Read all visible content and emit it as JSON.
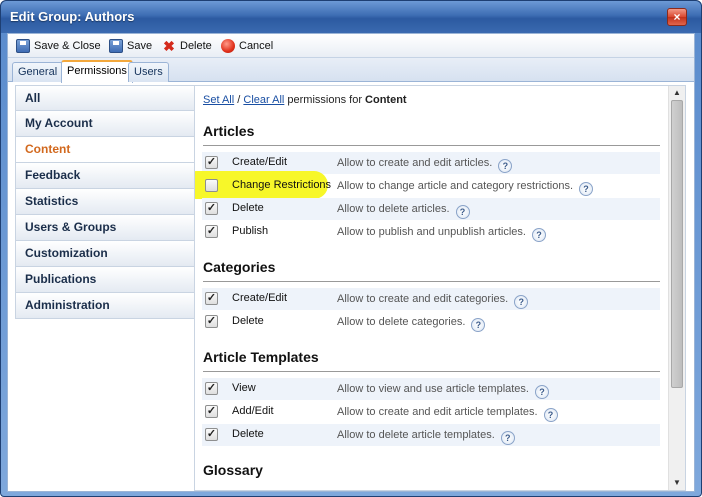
{
  "window": {
    "title": "Edit Group: Authors",
    "close_glyph": "×"
  },
  "toolbar": {
    "save_close": "Save & Close",
    "save": "Save",
    "delete": "Delete",
    "cancel": "Cancel"
  },
  "tabs": [
    {
      "label": "General"
    },
    {
      "label": "Permissions",
      "active": true
    },
    {
      "label": "Users"
    }
  ],
  "sidebar": {
    "items": [
      {
        "label": "All"
      },
      {
        "label": "My Account"
      },
      {
        "label": "Content",
        "active": true
      },
      {
        "label": "Feedback"
      },
      {
        "label": "Statistics"
      },
      {
        "label": "Users & Groups"
      },
      {
        "label": "Customization"
      },
      {
        "label": "Publications"
      },
      {
        "label": "Administration"
      }
    ]
  },
  "content": {
    "set_all": "Set All",
    "separator": "/",
    "clear_all": "Clear All",
    "permissions_for": "permissions for",
    "target": "Content",
    "help_glyph": "?",
    "sections": [
      {
        "title": "Articles",
        "rows": [
          {
            "name": "Create/Edit",
            "desc": "Allow to create and edit articles.",
            "checked": true
          },
          {
            "name": "Change Restrictions",
            "desc": "Allow to change article and category restrictions.",
            "checked": false,
            "highlighted": true
          },
          {
            "name": "Delete",
            "desc": "Allow to delete articles.",
            "checked": true
          },
          {
            "name": "Publish",
            "desc": "Allow to publish and unpublish articles.",
            "checked": true
          }
        ]
      },
      {
        "title": "Categories",
        "rows": [
          {
            "name": "Create/Edit",
            "desc": "Allow to create and edit categories.",
            "checked": true
          },
          {
            "name": "Delete",
            "desc": "Allow to delete categories.",
            "checked": true
          }
        ]
      },
      {
        "title": "Article Templates",
        "rows": [
          {
            "name": "View",
            "desc": "Allow to view and use article templates.",
            "checked": true
          },
          {
            "name": "Add/Edit",
            "desc": "Allow to create and edit article templates.",
            "checked": true
          },
          {
            "name": "Delete",
            "desc": "Allow to delete article templates.",
            "checked": true
          }
        ]
      },
      {
        "title": "Glossary",
        "rows": []
      }
    ]
  },
  "colors": {
    "title_bar": "#3d6db3",
    "active_side_item": "#d2691e",
    "highlight": "#f7f71e",
    "link": "#1a4fa3"
  }
}
